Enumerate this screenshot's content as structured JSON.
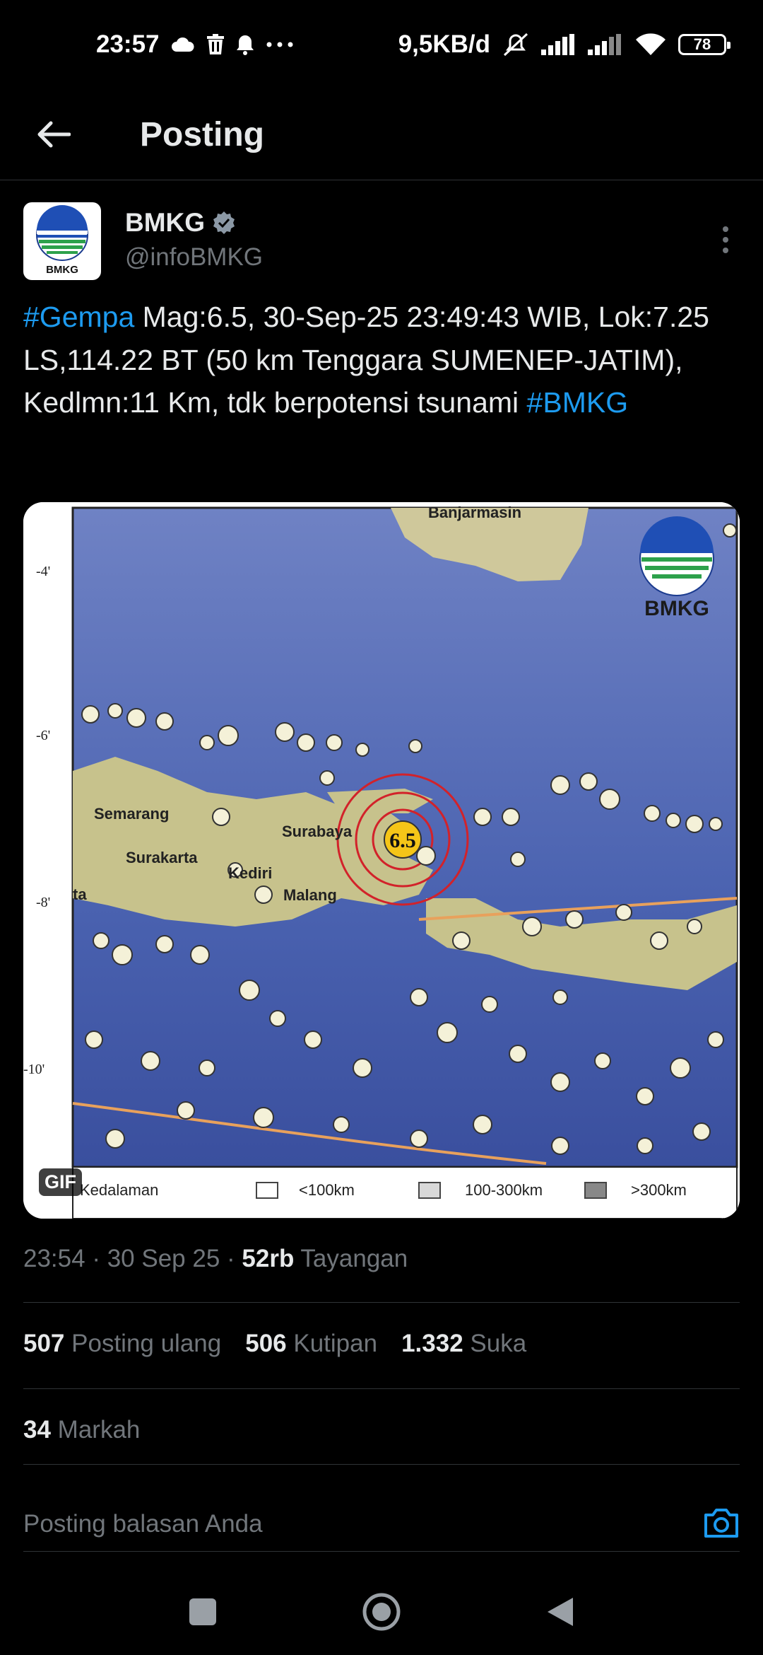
{
  "status_bar": {
    "time": "23:57",
    "left_icons": [
      "cloud-icon",
      "trash-icon",
      "bell-icon",
      "more-dots-icon"
    ],
    "net_speed": "9,5KB/d",
    "right_icons": [
      "mute-icon",
      "signal-icon",
      "signal-icon",
      "wifi-icon"
    ],
    "battery": "78"
  },
  "top_bar": {
    "title": "Posting",
    "back_icon": "arrow-left-icon"
  },
  "post": {
    "author_name": "BMKG",
    "author_handle": "@infoBMKG",
    "verified_icon": "verified-badge-icon",
    "avatar_label": "BMKG",
    "text_hashtag_1": "#Gempa",
    "text_body": " Mag:6.5, 30-Sep-25 23:49:43 WIB, Lok:7.25 LS,114.22 BT (50 km Tenggara SUMENEP-JATIM), Kedlmn:11 Km, tdk berpotensi tsunami ",
    "text_hashtag_2": "#BMKG",
    "more_icon": "more-vertical-icon"
  },
  "media": {
    "gif_badge": "GIF",
    "map": {
      "logo_text": "BMKG",
      "lat_labels": [
        "-4'",
        "-6'",
        "-8'",
        "-10'"
      ],
      "city_labels": [
        "Semarang",
        "Surakarta",
        "Kediri",
        "Surabaya",
        "Malang",
        "Banjarmasin",
        "ta"
      ],
      "magnitude": "6.5",
      "legend": {
        "title": "Kedalaman",
        "items": [
          "<100km",
          "100-300km",
          ">300km"
        ]
      }
    }
  },
  "meta": {
    "time": "23:54",
    "sep1": " · ",
    "date": "30 Sep 25",
    "sep2": " · ",
    "views_count": "52rb",
    "views_label": " Tayangan"
  },
  "stats": {
    "reposts_count": "507",
    "reposts_label": " Posting ulang",
    "quotes_count": "506",
    "quotes_label": " Kutipan",
    "likes_count": "1.332",
    "likes_label": " Suka",
    "bookmarks_count": "34",
    "bookmarks_label": " Markah"
  },
  "reply": {
    "placeholder": "Posting balasan Anda",
    "camera_icon": "camera-icon"
  },
  "nav": [
    "recents-square-icon",
    "home-circle-icon",
    "back-triangle-icon"
  ]
}
